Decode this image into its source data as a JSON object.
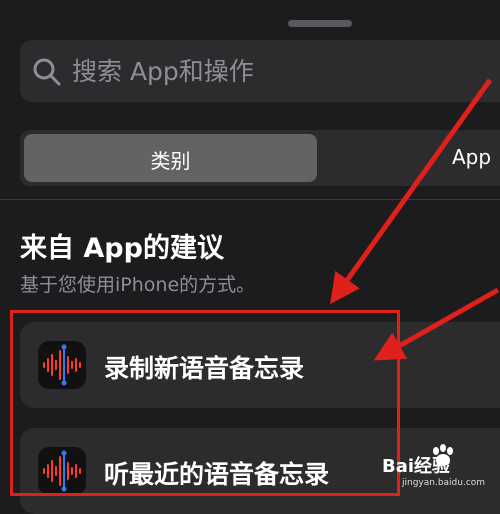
{
  "search": {
    "placeholder": "搜索 App和操作"
  },
  "segments": [
    {
      "label": "类别",
      "selected": true
    },
    {
      "label": "App",
      "selected": false
    }
  ],
  "section": {
    "title": "来自 App的建议",
    "subtitle": "基于您使用iPhone的方式。"
  },
  "suggestions": [
    {
      "label": "录制新语音备忘录",
      "icon": "voice-memos-icon"
    },
    {
      "label": "听最近的语音备忘录",
      "icon": "voice-memos-icon"
    }
  ],
  "watermark": {
    "brand": "Bai经验",
    "url": "jingyan.baidu.com"
  },
  "colors": {
    "annotation": "#e0201a",
    "waveform": "#ff3b30",
    "background": "#1c1c1e"
  }
}
